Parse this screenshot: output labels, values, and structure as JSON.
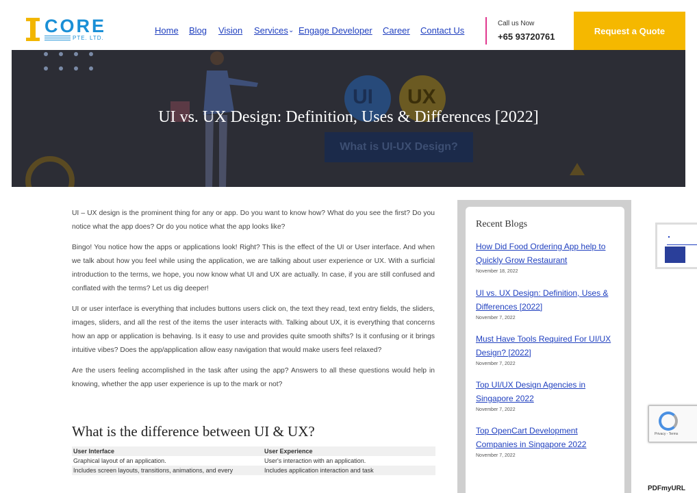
{
  "header": {
    "logo_word": "CORE",
    "logo_sub": "PTE. LTD.",
    "nav": [
      {
        "label": "Home"
      },
      {
        "label": "Blog"
      },
      {
        "label": "Vision"
      },
      {
        "label": "Services"
      },
      {
        "label": "Engage Developer"
      },
      {
        "label": "Career"
      },
      {
        "label": "Contact Us"
      }
    ],
    "call_label": "Call us Now",
    "call_number": "+65 93720761",
    "quote_button": "Request a Quote"
  },
  "hero": {
    "title": "UI vs. UX Design: Definition, Uses & Differences [2022]",
    "badge_ui": "UI",
    "badge_ux": "UX",
    "banner_caption": "What is UI-UX Design?"
  },
  "article": {
    "paragraphs": [
      "UI – UX design is the prominent thing for any or app. Do you want to know how? What do you see the first? Do you notice what the app does? Or do you notice what the app looks like?",
      "Bingo! You notice how the apps or applications look! Right? This is the effect of the UI or User interface. And when we talk about how you feel while using the application, we are talking about user experience or UX. With a surficial introduction to the terms, we hope, you now know what UI and UX are actually. In case, if you are still confused and conflated with the terms? Let us dig deeper!",
      "UI or user interface is everything that includes buttons users click on, the text they read, text entry fields, the sliders, images, sliders, and all the rest of the items the user interacts with. Talking about UX, it is everything that concerns how an app or application is behaving. Is it easy to use and provides quite smooth shifts? Is it confusing or it brings intuitive vibes? Does the app/application allow easy navigation that would make users feel relaxed?",
      "Are the users feeling accomplished in the task after using the app? Answers to all these questions would help in knowing, whether the app user experience is up to the mark or not?"
    ],
    "heading": "What is the difference between UI & UX?",
    "table": {
      "headers": [
        "User Interface",
        "User Experience"
      ],
      "rows": [
        [
          "Graphical layout of an application.",
          "User's interaction with an application."
        ],
        [
          "Includes screen layouts, transitions, animations, and every",
          "Includes application interaction and task"
        ]
      ]
    }
  },
  "sidebar": {
    "title": "Recent Blogs",
    "items": [
      {
        "title": "How Did Food Ordering App help to Quickly Grow Restaurant",
        "date": "November 18, 2022"
      },
      {
        "title": "UI vs. UX Design: Definition, Uses & Differences [2022]",
        "date": "November 7, 2022"
      },
      {
        "title": "Must Have Tools Required For UI/UX Design? [2022]",
        "date": "November 7, 2022"
      },
      {
        "title": "Top UI/UX Design Agencies in Singapore 2022",
        "date": "November 7, 2022"
      },
      {
        "title": "Top OpenCart Development Companies in Singapore 2022",
        "date": "November 7, 2022"
      }
    ]
  },
  "recaptcha": {
    "links": "Privacy - Terms"
  },
  "watermark": "PDFmyURL"
}
